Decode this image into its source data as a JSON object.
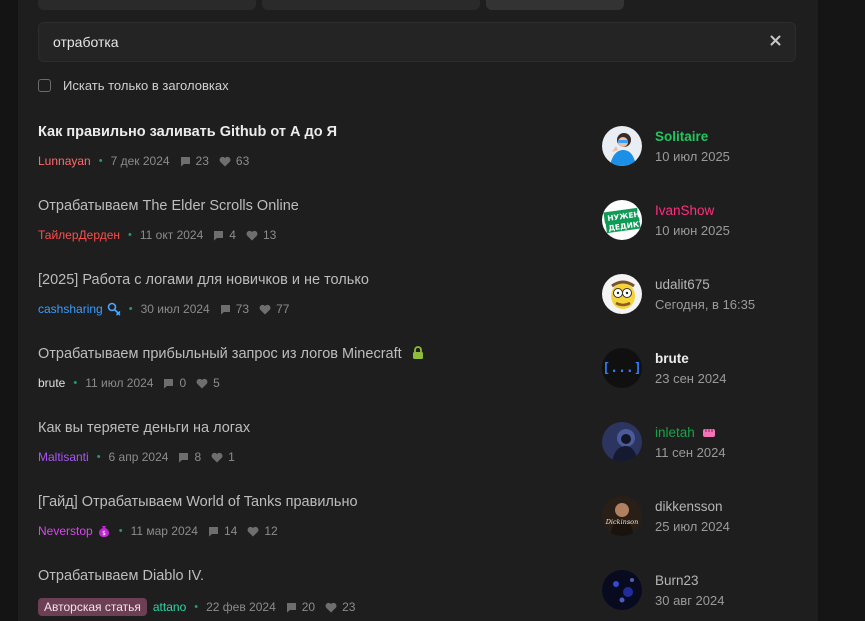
{
  "search": {
    "value": "отработка",
    "clear_icon": "close-icon",
    "titles_only_label": "Искать только в заголовках"
  },
  "results": [
    {
      "title": "Как правильно заливать Github от А до Я",
      "author": "Lunnayan",
      "author_color": "#ff6b6b",
      "date": "7 дек 2024",
      "replies": "23",
      "likes": "63",
      "last_user": "Solitaire",
      "last_user_color": "#22c55e",
      "last_date": "10 июл 2025"
    },
    {
      "title": "Отрабатываем The Elder Scrolls Online",
      "author": "ТайлерДерден",
      "author_color": "#ff4d4d",
      "date": "11 окт 2024",
      "replies": "4",
      "likes": "13",
      "last_user": "IvanShow",
      "last_user_color": "#ff2e7e",
      "last_date": "10 июн 2025",
      "avatar_text_1": "НУЖЕН",
      "avatar_text_2": "ДЕДИК?"
    },
    {
      "title": "[2025] Работа с логами для новичков и не только",
      "author": "cashsharing",
      "author_color": "#3b9dff",
      "date": "30 июл 2024",
      "replies": "73",
      "likes": "77",
      "last_user": "udalit675",
      "last_user_color": "#b5b5b5",
      "last_date": "Сегодня, в 16:35"
    },
    {
      "title": "Отрабатываем прибыльный запрос из логов Minecraft",
      "author": "brute",
      "author_color": "#e0e0e0",
      "date": "11 июл 2024",
      "replies": "0",
      "likes": "5",
      "last_user": "brute",
      "last_user_color": "#ececec",
      "last_date": "23 сен 2024",
      "avatar_text_1": "[...]"
    },
    {
      "title": "Как вы теряете деньги на логах",
      "author": "Maltisanti",
      "author_color": "#a855f7",
      "date": "6 апр 2024",
      "replies": "8",
      "likes": "1",
      "last_user": "inletah",
      "last_user_color": "#16a34a",
      "last_date": "11 сен 2024"
    },
    {
      "title": "[Гайд] Отрабатываем World of Tanks правильно",
      "author": "Neverstop",
      "author_color": "#d946ef",
      "date": "11 мар 2024",
      "replies": "14",
      "likes": "12",
      "last_user": "dikkensson",
      "last_user_color": "#b5b5b5",
      "last_date": "25 июл 2024",
      "avatar_text_1": "Dickinson"
    },
    {
      "title": "Отрабатываем Diablo IV.",
      "tag": "Авторская статья",
      "author": "attano",
      "author_color": "#2dd4a6",
      "date": "22 фев 2024",
      "replies": "20",
      "likes": "23",
      "last_user": "Burn23",
      "last_user_color": "#b5b5b5",
      "last_date": "30 авг 2024"
    }
  ],
  "colors": {
    "background": "#141414",
    "panel": "#1e1e1e",
    "dot": "#1f9d6b",
    "tag_bg": "#6d3f55",
    "lock": "#8fbc3a"
  }
}
